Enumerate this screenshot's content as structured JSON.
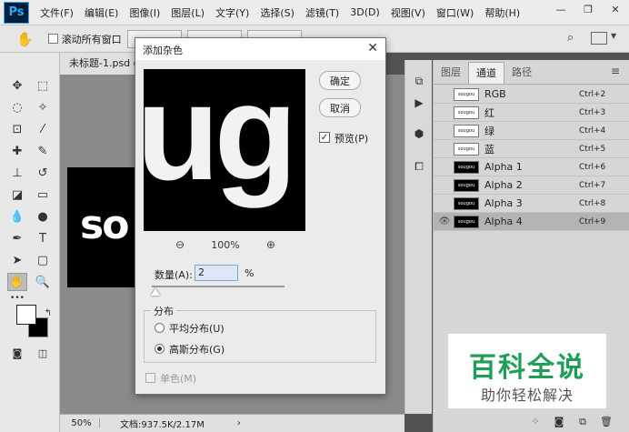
{
  "app": {
    "logo": "Ps",
    "menu": [
      "文件(F)",
      "编辑(E)",
      "图像(I)",
      "图层(L)",
      "文字(Y)",
      "选择(S)",
      "滤镜(T)",
      "3D(D)",
      "视图(V)",
      "窗口(W)",
      "帮助(H)"
    ],
    "window_controls": [
      "—",
      "❐",
      "✕"
    ]
  },
  "options_bar": {
    "scroll_all_label": "滚动所有窗口"
  },
  "document": {
    "tab_title": "未标题-1.psd @",
    "canvas_text": "so",
    "zoom": "50%",
    "doc_info": "文档:937.5K/2.17M"
  },
  "dialog": {
    "title": "添加杂色",
    "preview_text": "ug",
    "ok_label": "确定",
    "cancel_label": "取消",
    "preview_label": "预览(P)",
    "preview_checked": true,
    "zoom_level": "100%",
    "amount_label": "数量(A):",
    "amount_value": "2",
    "amount_unit": "%",
    "amount_slider_fraction": 0.02,
    "distribution_title": "分布",
    "distribution_options": [
      "平均分布(U)",
      "高斯分布(G)"
    ],
    "distribution_selected": "高斯分布(G)",
    "monochrome_label": "单色(M)",
    "monochrome_checked": false
  },
  "channels_panel": {
    "tabs": [
      "图层",
      "通道",
      "路径"
    ],
    "active_tab": "通道",
    "thumb_text": "sougou",
    "channels": [
      {
        "name": "RGB",
        "shortcut": "Ctrl+2",
        "thumb": "white",
        "visible": false,
        "selected": false
      },
      {
        "name": "红",
        "shortcut": "Ctrl+3",
        "thumb": "white",
        "visible": false,
        "selected": false
      },
      {
        "name": "绿",
        "shortcut": "Ctrl+4",
        "thumb": "white",
        "visible": false,
        "selected": false
      },
      {
        "name": "蓝",
        "shortcut": "Ctrl+5",
        "thumb": "white",
        "visible": false,
        "selected": false
      },
      {
        "name": "Alpha 1",
        "shortcut": "Ctrl+6",
        "thumb": "black",
        "visible": false,
        "selected": false
      },
      {
        "name": "Alpha 2",
        "shortcut": "Ctrl+7",
        "thumb": "black",
        "visible": false,
        "selected": false
      },
      {
        "name": "Alpha 3",
        "shortcut": "Ctrl+8",
        "thumb": "black",
        "visible": false,
        "selected": false
      },
      {
        "name": "Alpha 4",
        "shortcut": "Ctrl+9",
        "thumb": "black",
        "visible": true,
        "selected": true
      }
    ]
  },
  "watermark": {
    "title": "百科全说",
    "subtitle": "助你轻松解决",
    "color": "#1e9e57"
  },
  "colors": {
    "foreground": "#ffffff",
    "background": "#000000",
    "canvas_bg": "#8a8a8a"
  }
}
